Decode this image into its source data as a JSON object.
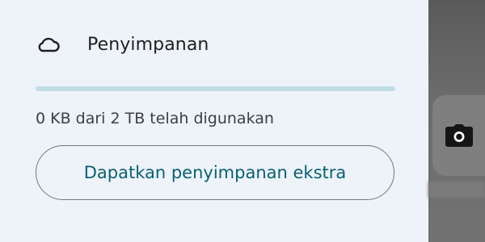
{
  "storage": {
    "icon": "cloud-icon",
    "title": "Penyimpanan",
    "used_fraction": 0.0,
    "usage_text": "0 KB dari 2 TB telah digunakan",
    "cta_label": "Dapatkan penyimpanan ekstra"
  },
  "side": {
    "camera_icon": "camera-icon"
  },
  "colors": {
    "drawer_bg": "#eef3fa",
    "progress_track": "#c1dde6",
    "accent_text": "#0b6070"
  }
}
